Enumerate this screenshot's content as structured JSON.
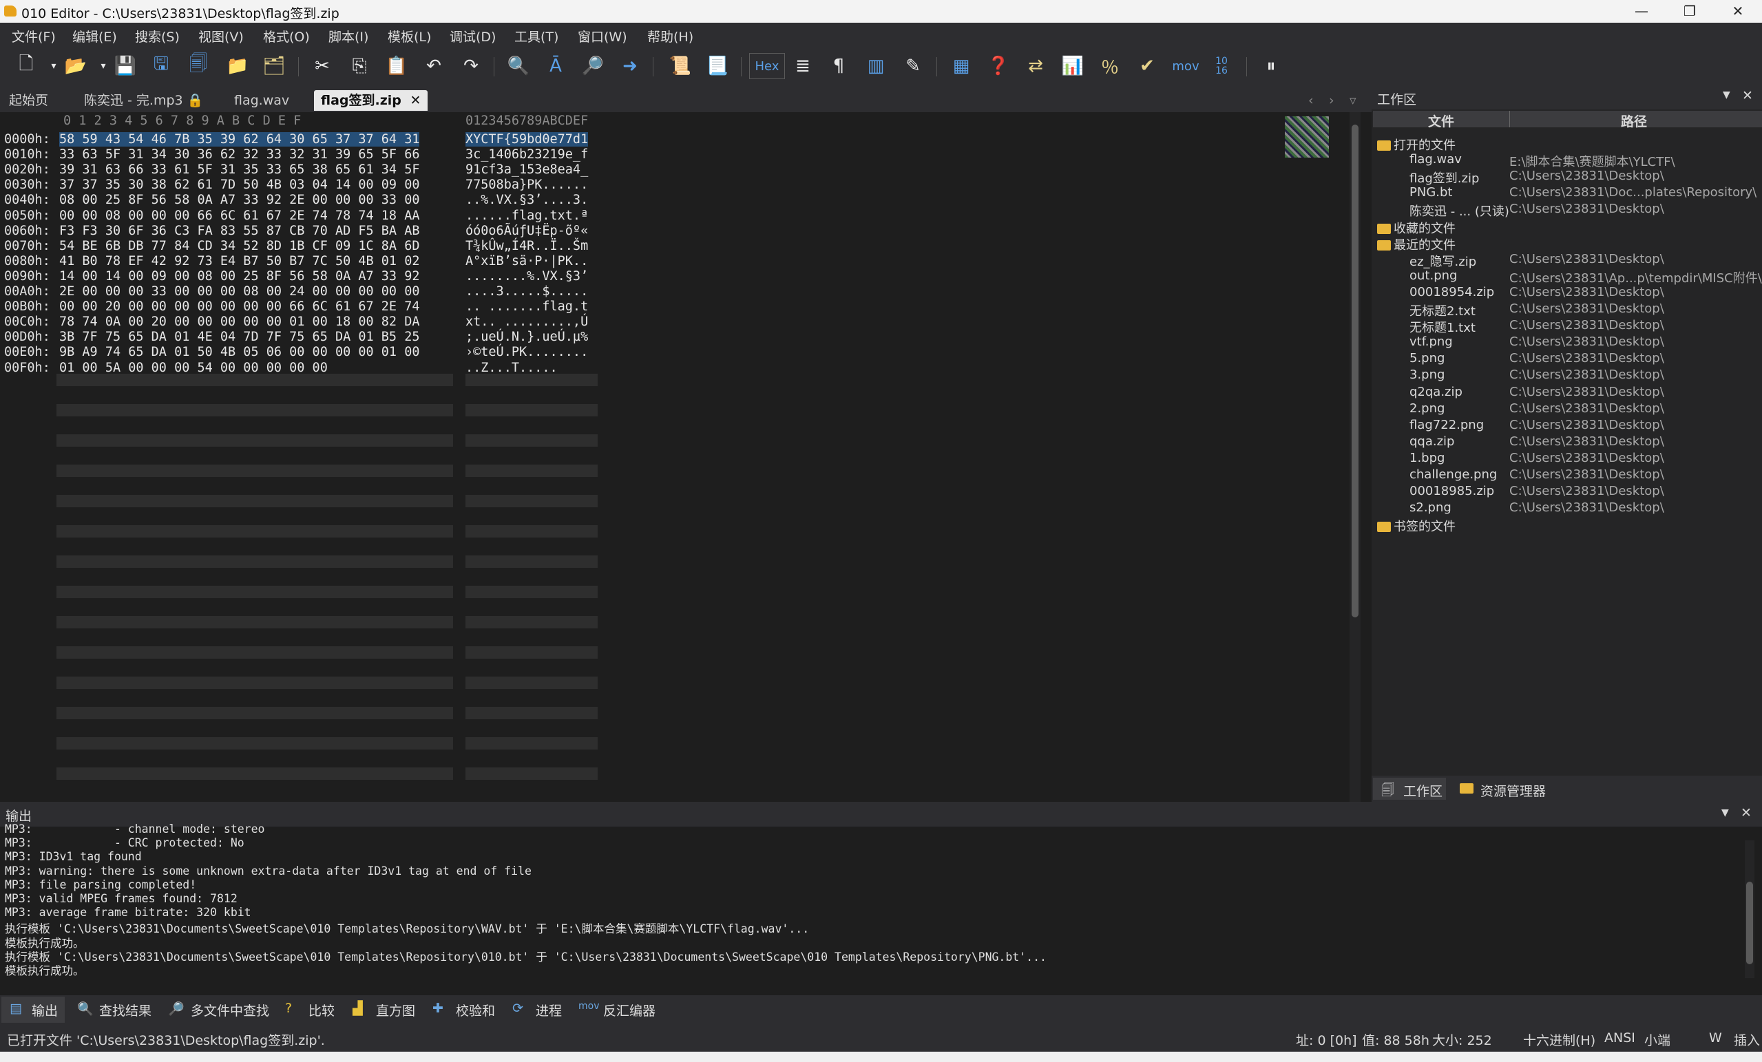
{
  "window": {
    "title": "010 Editor - C:\\Users\\23831\\Desktop\\flag签到.zip",
    "minimize": "—",
    "maximize": "❐",
    "close": "✕"
  },
  "menu": [
    "文件(F)",
    "编辑(E)",
    "搜索(S)",
    "视图(V)",
    "格式(O)",
    "脚本(I)",
    "模板(L)",
    "调试(D)",
    "工具(T)",
    "窗口(W)",
    "帮助(H)"
  ],
  "toolbar": {
    "hex_label": "Hex",
    "mov_label": "mov",
    "base_label": "10\n16"
  },
  "tabs": [
    {
      "label": "起始页"
    },
    {
      "label": "陈奕迅 - 完.mp3"
    },
    {
      "label": "flag.wav"
    },
    {
      "label": "flag签到.zip"
    }
  ],
  "hex": {
    "column_header": "0  1  2  3  4  5  6  7  8  9  A  B  C  D  E  F",
    "ascii_header": "0123456789ABCDEF",
    "rows": [
      {
        "addr": "0000h:",
        "hex": "58 59 43 54 46 7B 35 39 62 64 30 65 37 37 64 31",
        "ascii": "XYCTF{59bd0e77d1"
      },
      {
        "addr": "0010h:",
        "hex": "33 63 5F 31 34 30 36 62 32 33 32 31 39 65 5F 66",
        "ascii": "3c_1406b23219e_f"
      },
      {
        "addr": "0020h:",
        "hex": "39 31 63 66 33 61 5F 31 35 33 65 38 65 61 34 5F",
        "ascii": "91cf3a_153e8ea4_"
      },
      {
        "addr": "0030h:",
        "hex": "37 37 35 30 38 62 61 7D 50 4B 03 04 14 00 09 00",
        "ascii": "77508ba}PK......"
      },
      {
        "addr": "0040h:",
        "hex": "08 00 25 8F 56 58 0A A7 33 92 2E 00 00 00 33 00",
        "ascii": "..%.VX.§3’....3."
      },
      {
        "addr": "0050h:",
        "hex": "00 00 08 00 00 00 66 6C 61 67 2E 74 78 74 18 AA",
        "ascii": "......flag.txt.ª"
      },
      {
        "addr": "0060h:",
        "hex": "F3 F3 30 6F 36 C3 FA 83 55 87 CB 70 AD F5 BA AB",
        "ascii": "óó0o6ÃúƒU‡Ëp-õº«"
      },
      {
        "addr": "0070h:",
        "hex": "54 BE 6B DB 77 84 CD 34 52 8D 1B CF 09 1C 8A 6D",
        "ascii": "T¾kÛw„Í4R..Ï..Šm"
      },
      {
        "addr": "0080h:",
        "hex": "41 B0 78 EF 42 92 73 E4 B7 50 B7 7C 50 4B 01 02",
        "ascii": "A°xïB’sä·P·|PK.."
      },
      {
        "addr": "0090h:",
        "hex": "14 00 14 00 09 00 08 00 25 8F 56 58 0A A7 33 92",
        "ascii": "........%.VX.§3’"
      },
      {
        "addr": "00A0h:",
        "hex": "2E 00 00 00 33 00 00 00 08 00 24 00 00 00 00 00",
        "ascii": "....3.....$....."
      },
      {
        "addr": "00B0h:",
        "hex": "00 00 20 00 00 00 00 00 00 00 66 6C 61 67 2E 74",
        "ascii": ".. .......flag.t"
      },
      {
        "addr": "00C0h:",
        "hex": "78 74 0A 00 20 00 00 00 00 00 01 00 18 00 82 DA",
        "ascii": "xt.. .........‚Ú"
      },
      {
        "addr": "00D0h:",
        "hex": "3B 7F 75 65 DA 01 4E 04 7D 7F 75 65 DA 01 B5 25",
        "ascii": ";.ueÚ.N.}.ueÚ.µ%"
      },
      {
        "addr": "00E0h:",
        "hex": "9B A9 74 65 DA 01 50 4B 05 06 00 00 00 00 01 00",
        "ascii": "›©teÚ.PK........"
      },
      {
        "addr": "00F0h:",
        "hex": "01 00 5A 00 00 00 54 00 00 00 00 00",
        "ascii": "..Z...T....."
      }
    ]
  },
  "workspace": {
    "title": "工作区",
    "col_file": "文件",
    "col_path": "路径",
    "open_files_label": "打开的文件",
    "open_files": [
      {
        "name": "flag.wav",
        "path": "E:\\脚本合集\\赛题脚本\\YLCTF\\"
      },
      {
        "name": "flag签到.zip",
        "path": "C:\\Users\\23831\\Desktop\\"
      },
      {
        "name": "PNG.bt",
        "path": "C:\\Users\\23831\\Doc...plates\\Repository\\"
      },
      {
        "name": "陈奕迅 - ... (只读)",
        "path": "C:\\Users\\23831\\Desktop\\"
      }
    ],
    "favorites_label": "收藏的文件",
    "recent_label": "最近的文件",
    "recent_files": [
      {
        "name": "ez_隐写.zip",
        "path": "C:\\Users\\23831\\Desktop\\"
      },
      {
        "name": "out.png",
        "path": "C:\\Users\\23831\\Ap...p\\tempdir\\MISC附件\\"
      },
      {
        "name": "00018954.zip",
        "path": "C:\\Users\\23831\\Desktop\\"
      },
      {
        "name": "无标题2.txt",
        "path": "C:\\Users\\23831\\Desktop\\"
      },
      {
        "name": "无标题1.txt",
        "path": "C:\\Users\\23831\\Desktop\\"
      },
      {
        "name": "vtf.png",
        "path": "C:\\Users\\23831\\Desktop\\"
      },
      {
        "name": "5.png",
        "path": "C:\\Users\\23831\\Desktop\\"
      },
      {
        "name": "3.png",
        "path": "C:\\Users\\23831\\Desktop\\"
      },
      {
        "name": "q2qa.zip",
        "path": "C:\\Users\\23831\\Desktop\\"
      },
      {
        "name": "2.png",
        "path": "C:\\Users\\23831\\Desktop\\"
      },
      {
        "name": "flag722.png",
        "path": "C:\\Users\\23831\\Desktop\\"
      },
      {
        "name": "qqa.zip",
        "path": "C:\\Users\\23831\\Desktop\\"
      },
      {
        "name": "1.bpg",
        "path": "C:\\Users\\23831\\Desktop\\"
      },
      {
        "name": "challenge.png",
        "path": "C:\\Users\\23831\\Desktop\\"
      },
      {
        "name": "00018985.zip",
        "path": "C:\\Users\\23831\\Desktop\\"
      },
      {
        "name": "s2.png",
        "path": "C:\\Users\\23831\\Desktop\\"
      }
    ],
    "bookmarks_label": "书签的文件",
    "tab_workspace": "工作区",
    "tab_explorer": "资源管理器"
  },
  "output": {
    "title": "输出",
    "lines": [
      "MP3:            - channel mode: stereo",
      "MP3:            - CRC protected: No",
      "MP3: ID3v1 tag found",
      "MP3: warning: there is some unknown extra-data after ID3v1 tag at end of file",
      "MP3: file parsing completed!",
      "MP3: valid MPEG frames found: 7812",
      "MP3: average frame bitrate: 320 kbit",
      "执行模板 'C:\\Users\\23831\\Documents\\SweetScape\\010 Templates\\Repository\\WAV.bt' 于 'E:\\脚本合集\\赛题脚本\\YLCTF\\flag.wav'...",
      "模板执行成功。",
      "执行模板 'C:\\Users\\23831\\Documents\\SweetScape\\010 Templates\\Repository\\010.bt' 于 'C:\\Users\\23831\\Documents\\SweetScape\\010 Templates\\Repository\\PNG.bt'...",
      "模板执行成功。"
    ],
    "tabs": [
      "输出",
      "查找结果",
      "多文件中查找",
      "比较",
      "直方图",
      "校验和",
      "进程",
      "反汇编器"
    ]
  },
  "status": {
    "message": "已打开文件 'C:\\Users\\23831\\Desktop\\flag签到.zip'.",
    "address": "址: 0 [0h]",
    "value": "值: 88 58h",
    "size": "大小: 252",
    "mode": "十六进制(H)",
    "encoding": "ANSI",
    "endian": "小端",
    "w": "W",
    "insert": "插入"
  }
}
